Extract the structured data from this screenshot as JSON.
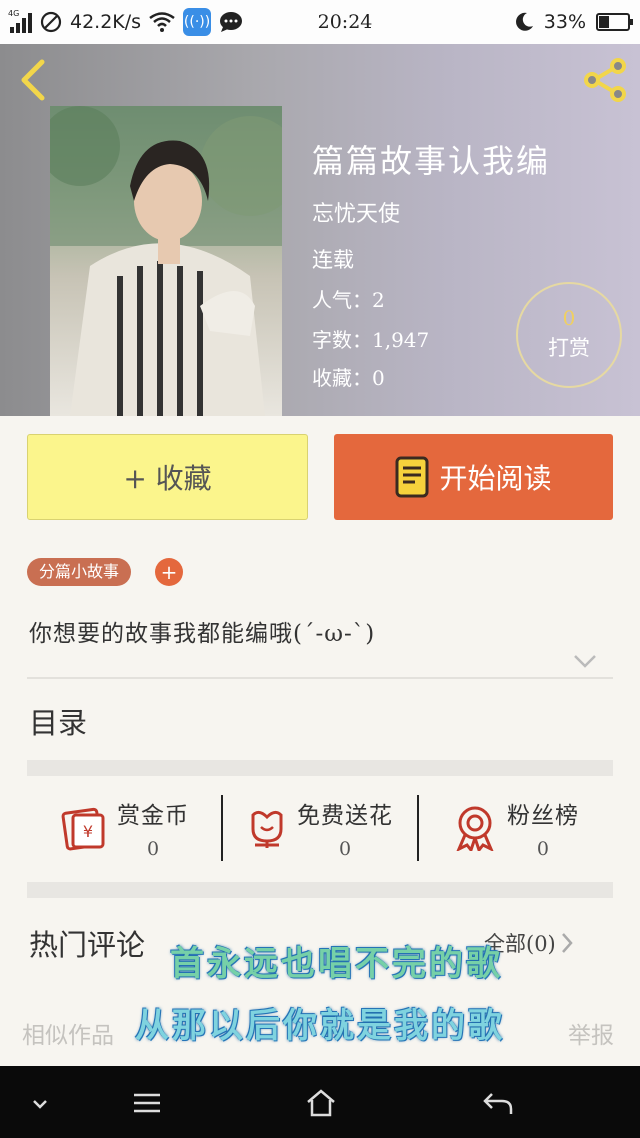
{
  "status_bar": {
    "network_type": "4G",
    "speed": "42.2K/s",
    "time": "20:24",
    "battery": "33%",
    "battery_level": 0.33
  },
  "book": {
    "title": "篇篇故事认我编",
    "author": "忘忧天使",
    "status": "连载",
    "popularity_label": "人气：2",
    "word_count_label": "字数：1,947",
    "favorites_label": "收藏：0",
    "reward_count": "0",
    "reward_label": "打赏"
  },
  "actions": {
    "favorite_label": "+ 收藏",
    "read_label": "开始阅读"
  },
  "tags": {
    "category": "分篇小故事",
    "add": "+"
  },
  "intro": "你想要的故事我都能编哦(´-ω-`)",
  "toc_label": "目录",
  "stats": [
    {
      "label": "赏金币",
      "value": "0"
    },
    {
      "label": "免费送花",
      "value": "0"
    },
    {
      "label": "粉丝榜",
      "value": "0"
    }
  ],
  "comments": {
    "title": "热门评论",
    "all_label": "全部(0)"
  },
  "footer": {
    "similar_label": "相似作品",
    "report_label": "举报"
  },
  "overlay_lyrics": {
    "line1": "首永远也唱不完的歌",
    "line2": "从那以后你就是我的歌"
  },
  "colors": {
    "accent_orange": "#e4683d",
    "favorite_yellow": "#fbf58c",
    "icon_red": "#c0392b"
  }
}
